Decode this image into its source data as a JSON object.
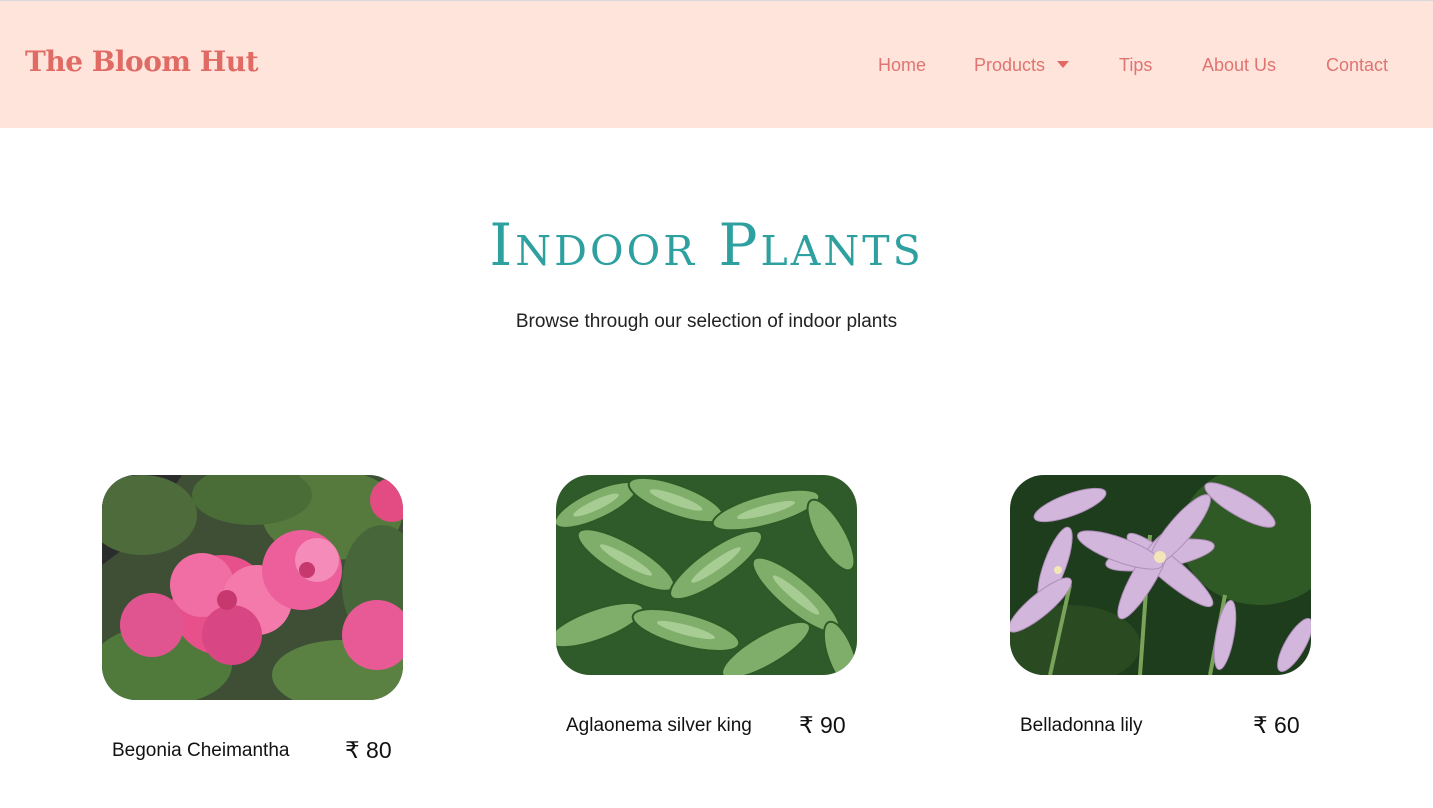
{
  "brand": {
    "name": "The Bloom Hut",
    "primary_color": "#e06a64",
    "header_bg": "#ffe4dc",
    "title_color": "#2fa0a0"
  },
  "nav": {
    "home": "Home",
    "products": "Products",
    "tips": "Tips",
    "about": "About Us",
    "contact": "Contact",
    "dropdown_icon": "caret-down-icon"
  },
  "hero": {
    "title": "Indoor Plants",
    "subtitle": "Browse through our selection of indoor plants"
  },
  "products": [
    {
      "name": "Begonia Cheimantha",
      "price": "₹ 80",
      "image": "pink-begonia-flowers"
    },
    {
      "name": "Aglaonema silver king",
      "price": "₹ 90",
      "image": "variegated-green-leaves"
    },
    {
      "name": "Belladonna lily",
      "price": "₹ 60",
      "image": "pale-pink-lily-flowers"
    }
  ]
}
